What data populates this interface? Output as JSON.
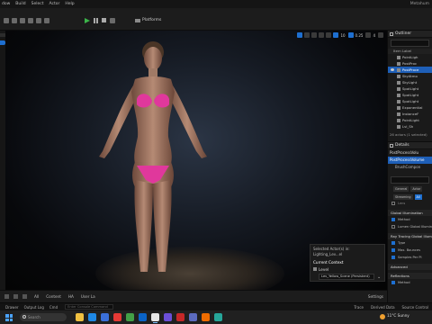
{
  "menubar": {
    "items": [
      "dow",
      "Build",
      "Select",
      "Actor",
      "Help"
    ],
    "window_title": "Metahum"
  },
  "toolbar": {
    "platforms_label": "Platforms"
  },
  "viewport": {
    "tool_labels": [
      "10",
      "0.25",
      "4"
    ]
  },
  "selection_popup": {
    "selected_actors": "Selected Actor(s) in:",
    "level_path": "Lighting_Lev...el",
    "current_context_label": "Current Context",
    "level_label": "Level",
    "level_value": "Lev_Yellow_Scene (Persistent)"
  },
  "outliner": {
    "title": "Outliner",
    "item_label_header": "Item Label",
    "rows": [
      {
        "label": "PointLigh",
        "selected": false,
        "eye": false
      },
      {
        "label": "PostProc",
        "selected": false,
        "eye": false
      },
      {
        "label": "PostProce",
        "selected": true,
        "eye": true
      },
      {
        "label": "SkyAtmo",
        "selected": false,
        "eye": false
      },
      {
        "label": "SkyLight",
        "selected": false,
        "eye": false
      },
      {
        "label": "SpotLight",
        "selected": false,
        "eye": false
      },
      {
        "label": "SpotLight",
        "selected": false,
        "eye": false
      },
      {
        "label": "SpotLight",
        "selected": false,
        "eye": false
      },
      {
        "label": "Exponential",
        "selected": false,
        "eye": false
      },
      {
        "label": "InstanceF",
        "selected": false,
        "eye": false
      },
      {
        "label": "PointLight",
        "selected": false,
        "eye": false
      },
      {
        "label": "Lvl_Sh",
        "selected": false,
        "eye": false
      }
    ],
    "actor_count": "26 actors (1 selected)"
  },
  "details": {
    "title": "Details",
    "object_name": "PostProcessVolu",
    "components": [
      "PostProcessVolume",
      "BrushCompon"
    ],
    "chips_row1": [
      "General",
      "Actor"
    ],
    "chips_row2": [
      "Streaming",
      "All"
    ],
    "filter_label": "Lens",
    "sections": [
      {
        "label": "Global Illumination",
        "items": [
          {
            "label": "Method",
            "checked": true
          },
          {
            "label": "Lumen Global Illumination",
            "checked": false
          }
        ]
      },
      {
        "label": "Ray Tracing Global Illum",
        "items": [
          {
            "label": "Type",
            "checked": true
          },
          {
            "label": "Max. Bounces",
            "checked": true
          },
          {
            "label": "Samples Per Pi",
            "checked": true
          }
        ]
      },
      {
        "label": "Advanced",
        "items": []
      },
      {
        "label": "Reflections",
        "items": [
          {
            "label": "Method",
            "checked": true
          }
        ]
      }
    ]
  },
  "content_bar": {
    "breadcrumbs": [
      "All",
      "Content",
      "HA",
      "User La"
    ],
    "settings_label": "Settings"
  },
  "statusbar": {
    "drawer": "Drawer",
    "log": "Output Log",
    "cmd": "Cmd",
    "cmd_placeholder": "Enter Console Command",
    "trace": "Trace",
    "derived": "Derived Data",
    "source_control": "Source Control"
  },
  "taskbar": {
    "search_placeholder": "Search",
    "weather": "11°C  Sunny"
  }
}
